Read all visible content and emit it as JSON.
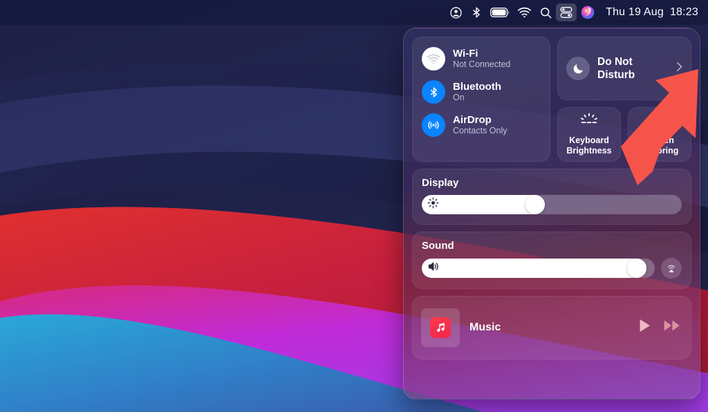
{
  "menubar": {
    "items": [
      {
        "name": "user-account-icon",
        "icon": "user-account-icon",
        "active": false
      },
      {
        "name": "bluetooth-icon",
        "icon": "bluetooth-icon",
        "active": false
      },
      {
        "name": "battery-icon",
        "icon": "battery-icon",
        "active": false
      },
      {
        "name": "wifi-icon",
        "icon": "wifi-icon",
        "active": false
      },
      {
        "name": "search-icon",
        "icon": "search-icon",
        "active": false
      },
      {
        "name": "control-center-icon",
        "icon": "control-center-icon",
        "active": true
      },
      {
        "name": "siri-icon",
        "icon": "siri-icon",
        "active": false
      }
    ],
    "date": "Thu 19 Aug",
    "time": "18:23"
  },
  "control_center": {
    "connectivity": [
      {
        "title": "Wi-Fi",
        "status": "Not Connected",
        "icon": "wifi-icon",
        "enabled": false
      },
      {
        "title": "Bluetooth",
        "status": "On",
        "icon": "bluetooth-icon",
        "enabled": true
      },
      {
        "title": "AirDrop",
        "status": "Contacts Only",
        "icon": "airdrop-icon",
        "enabled": true
      }
    ],
    "do_not_disturb": {
      "label": "Do Not Disturb",
      "icon": "moon-icon",
      "chevron": "chevron-right-icon",
      "enabled": false
    },
    "tiles": [
      {
        "label": "Keyboard Brightness",
        "icon": "keyboard-brightness-icon"
      },
      {
        "label": "Screen Mirroring",
        "icon": "screen-mirroring-icon"
      }
    ],
    "display": {
      "title": "Display",
      "icon": "brightness-icon",
      "value": 43
    },
    "sound": {
      "title": "Sound",
      "icon": "speaker-icon",
      "value": 96,
      "airplay_icon": "airplay-icon"
    },
    "music": {
      "title": "Music",
      "app_icon": "music-note-icon",
      "play_icon": "play-icon",
      "forward_icon": "fast-forward-icon"
    }
  },
  "annotation": {
    "arrow": "red-arrow-up-right",
    "color": "#f6544a"
  },
  "colors": {
    "accent_blue": "#0a84ff",
    "panel_text": "#ffffff",
    "annotation_red": "#f6544a"
  }
}
